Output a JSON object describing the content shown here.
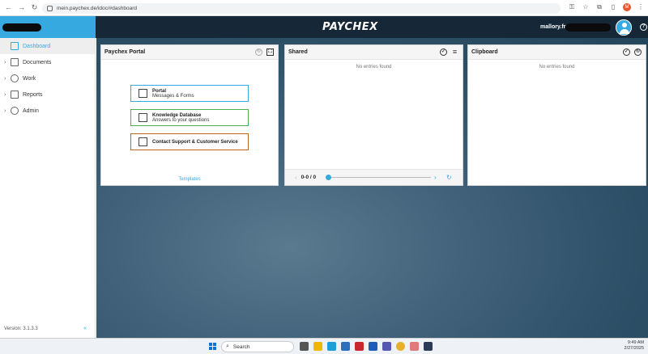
{
  "browser": {
    "url": "mein.paychex.de/idoc/#dashboard",
    "profile_initial": "M"
  },
  "header": {
    "brand": "PAYCHEX",
    "username": "mallory.franco",
    "help": "?"
  },
  "sidebar": {
    "items": [
      {
        "label": "Dashboard",
        "icon": "dashboard-icon"
      },
      {
        "label": "Documents",
        "icon": "document-icon"
      },
      {
        "label": "Work",
        "icon": "work-icon"
      },
      {
        "label": "Reports",
        "icon": "reports-icon"
      },
      {
        "label": "Admin",
        "icon": "gear-icon"
      }
    ],
    "version": "Version: 3.1.3.3",
    "collapse": "«"
  },
  "portal": {
    "title": "Paychex Portal",
    "tiles": [
      {
        "title": "Portal",
        "subtitle": "Messages & Forms",
        "color": "#36a9e1"
      },
      {
        "title": "Knowledge Database",
        "subtitle": "Answers to your questions",
        "color": "#4caf50"
      },
      {
        "title": "Contact Support & Customer Service",
        "subtitle": "",
        "color": "#c0671f"
      }
    ],
    "templates": "Templates"
  },
  "shared": {
    "title": "Shared",
    "empty": "No entries found",
    "pager": "0-0 / 0"
  },
  "clipboard": {
    "title": "Clipboard",
    "empty": "No entries found"
  },
  "taskbar": {
    "search_placeholder": "Search",
    "time": "9:49 AM",
    "date": "2/27/2025"
  },
  "colors": {
    "accent": "#36a9e1",
    "header_bg": "#162838"
  }
}
